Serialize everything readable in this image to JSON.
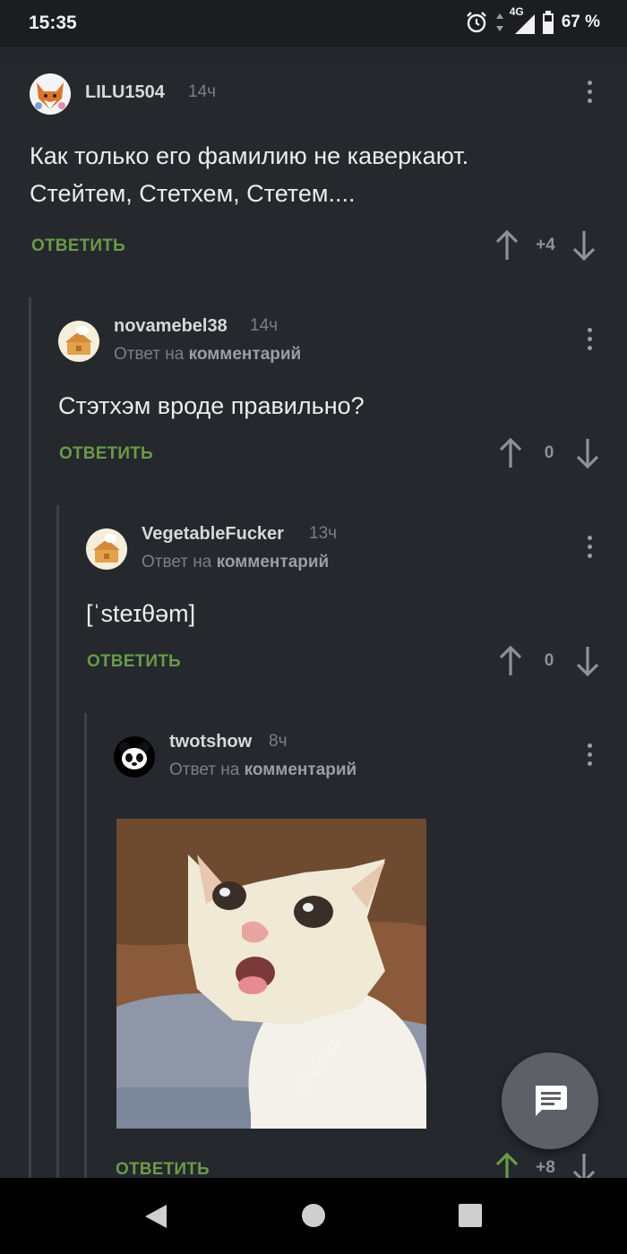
{
  "status_bar": {
    "time": "15:35",
    "network": "4G",
    "battery": "67 %",
    "icons": [
      "alarm-icon",
      "data-arrows-icon",
      "signal-icon",
      "battery-icon"
    ]
  },
  "comments": [
    {
      "author": "LILU1504",
      "time": "14ч",
      "text_lines": [
        "Как только его фамилию не каверкают.",
        "Стейтем, Стетхем, Стетем...."
      ],
      "reply_label": "ОТВЕТИТЬ",
      "votes": "+4",
      "avatar": "fox-avatar"
    },
    {
      "author": "novamebel38",
      "time": "14ч",
      "reply_prefix": "Ответ на",
      "reply_target": "комментарий",
      "text": "Стэтхэм вроде правильно?",
      "reply_label": "ОТВЕТИТЬ",
      "votes": "0",
      "avatar": "default-avatar"
    },
    {
      "author": "VegetableFucker",
      "time": "13ч",
      "reply_prefix": "Ответ на",
      "reply_target": "комментарий",
      "text": "[ˈsteɪθəm]",
      "reply_label": "ОТВЕТИТЬ",
      "votes": "0",
      "avatar": "default-avatar"
    },
    {
      "author": "twotshow",
      "time": "8ч",
      "reply_prefix": "Ответ на",
      "reply_target": "комментарий",
      "image": "coughing-cat-meme",
      "reply_label": "ОТВЕТИТЬ",
      "votes": "+8",
      "upvoted": true,
      "avatar": "panda-avatar"
    }
  ],
  "colors": {
    "background": "#25282d",
    "reply_green": "#6a9a49",
    "upvote_active": "#6a9a49",
    "muted": "#7b7f86"
  }
}
